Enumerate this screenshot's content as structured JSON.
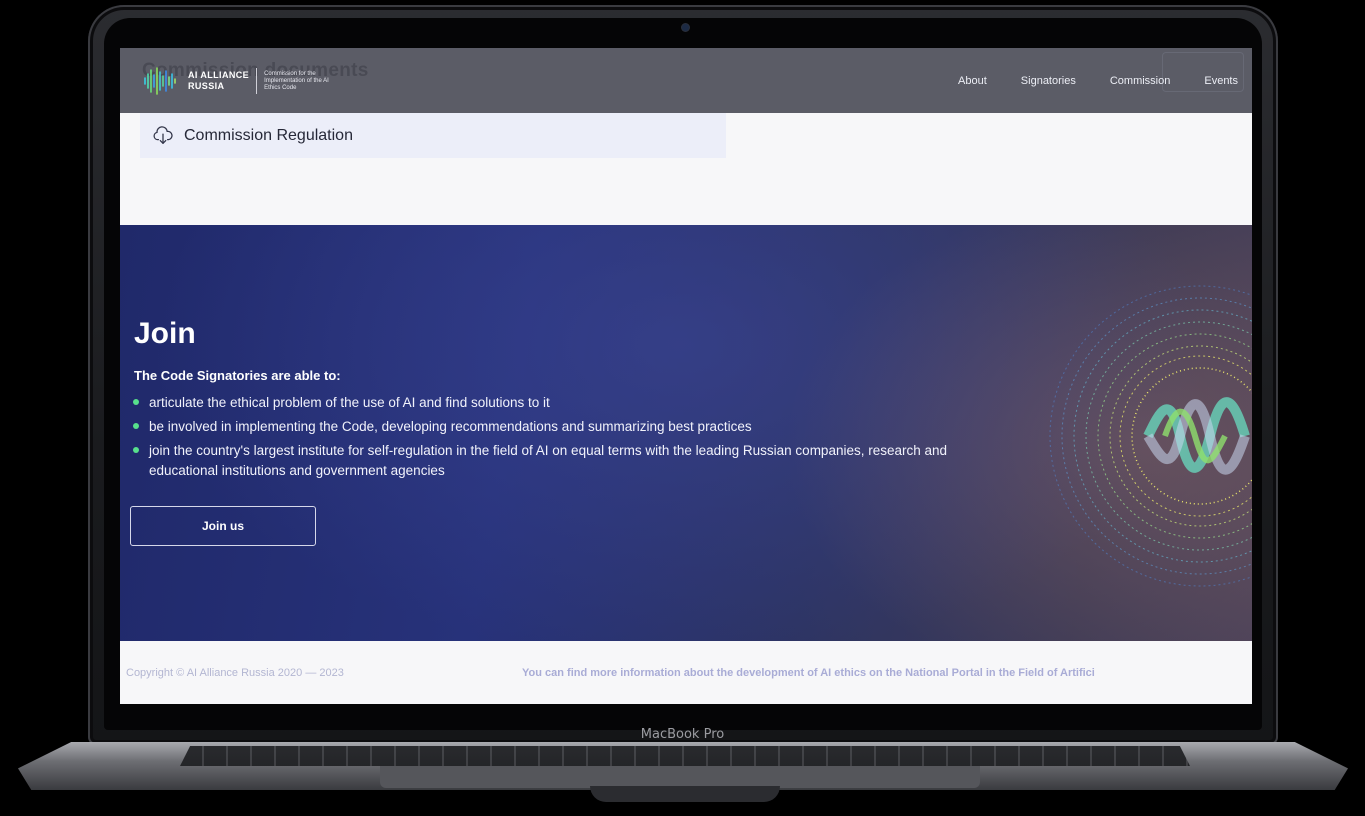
{
  "device": {
    "model_label": "MacBook Pro"
  },
  "header": {
    "ghost_title": "Commission documents",
    "logo": {
      "name_line1": "AI ALLIANCE",
      "name_line2": "RUSSIA",
      "desc_line1": "Commission for the",
      "desc_line2": "Implementation of the AI",
      "desc_line3": "Ethics Code"
    },
    "nav": [
      {
        "label": "About"
      },
      {
        "label": "Signatories"
      },
      {
        "label": "Commission"
      },
      {
        "label": "Events"
      }
    ]
  },
  "documents": [
    {
      "label": "Commission Regulation",
      "icon": "cloud-download-icon"
    }
  ],
  "join": {
    "title": "Join",
    "subtitle": "The Code Signatories are able to:",
    "items": [
      "articulate the ethical problem of the use of AI and find solutions to it",
      "be involved in implementing the Code, developing recommendations and summarizing best practices",
      "join the country's largest institute for self-regulation in the field of AI on equal terms with the leading Russian companies, research and educational institutions and government agencies"
    ],
    "button_label": "Join us"
  },
  "footer": {
    "copyright": "Copyright © AI Alliance Russia 2020 — 2023",
    "info": "You can find more information about the development of AI ethics on the National Portal in the Field of Artifici"
  },
  "colors": {
    "header_bg": "#5b5c66",
    "join_bg": "#25307a",
    "bullet": "#57e08c",
    "doc_row_bg": "#eceef9"
  }
}
